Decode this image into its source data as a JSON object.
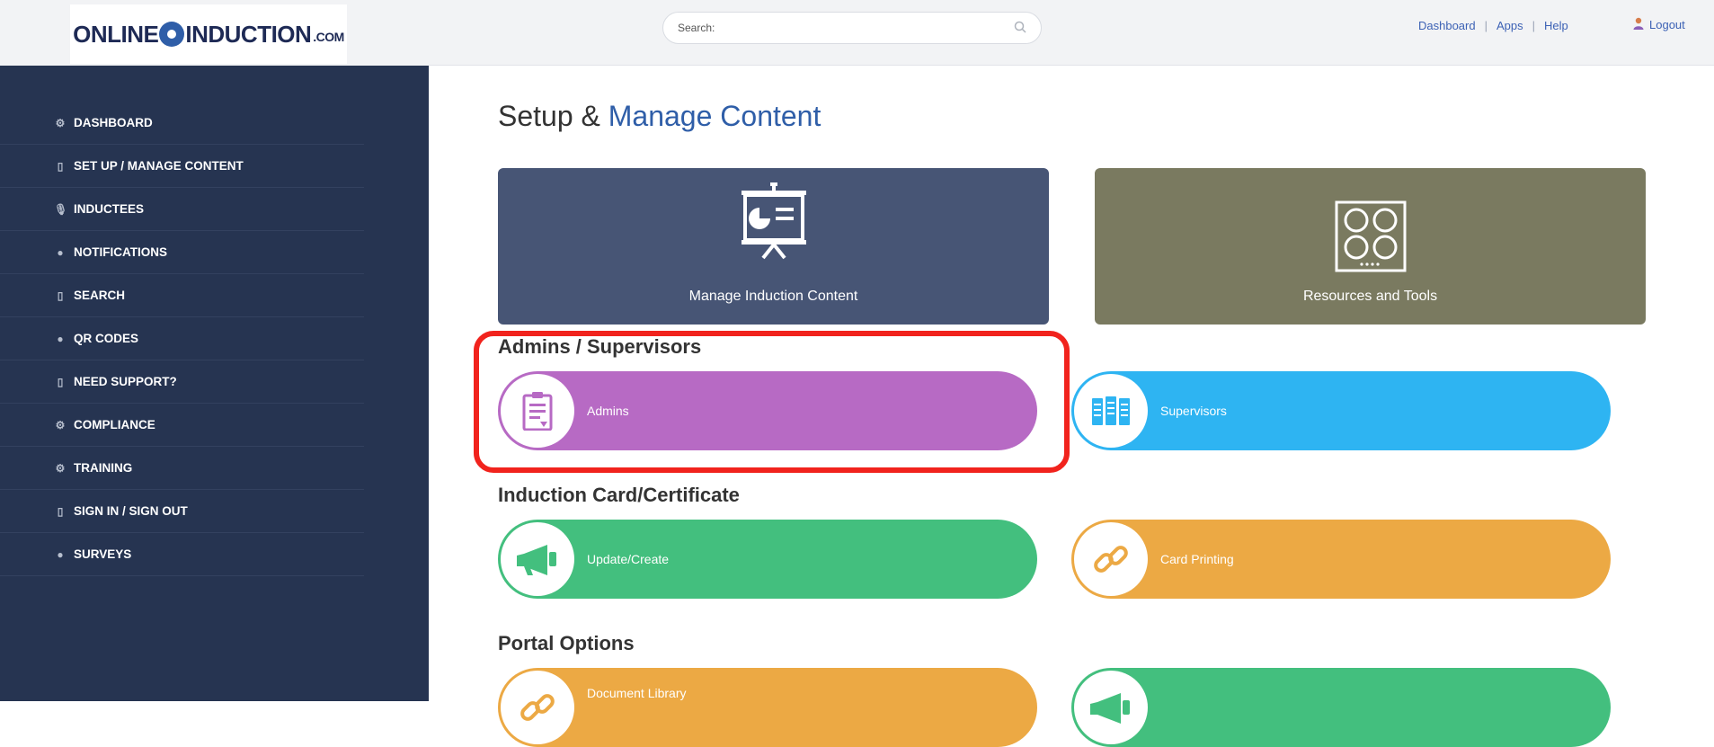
{
  "logo": {
    "brand": "ONLINE",
    "brand2": "INDUCTION",
    "suffix": ".COM"
  },
  "sidebar": {
    "items": [
      {
        "label": "DASHBOARD",
        "icon": "gear-icon"
      },
      {
        "label": "SET UP / MANAGE CONTENT",
        "icon": "document-icon"
      },
      {
        "label": "INDUCTEES",
        "icon": "microphone-icon"
      },
      {
        "label": "NOTIFICATIONS",
        "icon": "chat-icon"
      },
      {
        "label": "SEARCH",
        "icon": "document-icon"
      },
      {
        "label": "QR CODES",
        "icon": "chat-icon"
      },
      {
        "label": "NEED SUPPORT?",
        "icon": "document-icon"
      },
      {
        "label": "COMPLIANCE",
        "icon": "gear-icon"
      },
      {
        "label": "TRAINING",
        "icon": "gear-icon"
      },
      {
        "label": "SIGN IN / SIGN OUT",
        "icon": "document-icon"
      },
      {
        "label": "SURVEYS",
        "icon": "chat-icon"
      }
    ]
  },
  "header": {
    "search_placeholder": "Search:",
    "links": [
      "Dashboard",
      "Apps",
      "Help"
    ],
    "separator": "|",
    "logout": "Logout"
  },
  "main": {
    "title_prefix": "Setup & ",
    "title_accent": "Manage Content",
    "tiles": [
      {
        "label": "Manage Induction Content",
        "color": "#475575",
        "icon": "presentation-board-icon"
      },
      {
        "label": "Resources and Tools",
        "color": "#7a7a60",
        "icon": "grid-circles-icon"
      }
    ],
    "sections": {
      "admins": "Admins / Supervisors",
      "card": "Induction Card/Certificate",
      "portal": "Portal Options"
    },
    "pills": {
      "admins": {
        "label": "Admins",
        "color": "#b76ac4",
        "icon": "clipboard-icon"
      },
      "supervisors": {
        "label": "Supervisors",
        "color": "#2eb4f2",
        "icon": "binders-icon"
      },
      "update": {
        "label": "Update/Create",
        "color": "#43bf7e",
        "icon": "megaphone-icon"
      },
      "printing": {
        "label": "Card Printing",
        "color": "#eca944",
        "icon": "link-icon"
      },
      "document_library": {
        "label": "Document Library",
        "color": "#eca944",
        "icon": "link-icon"
      },
      "portal_second": {
        "label": "",
        "color": "#43bf7e",
        "icon": "megaphone-icon"
      }
    },
    "highlight_color": "#f1231d"
  }
}
